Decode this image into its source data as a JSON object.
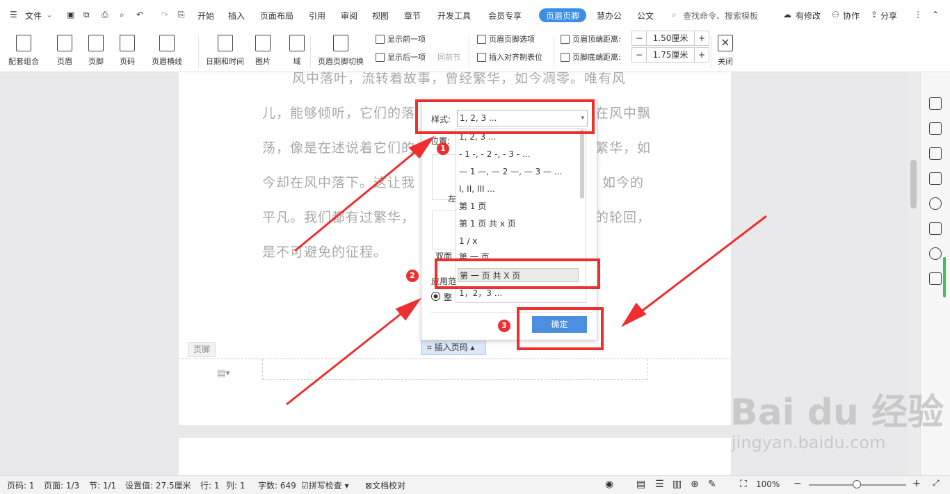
{
  "menubar": {
    "file": "文件",
    "tabs": [
      "开始",
      "插入",
      "页面布局",
      "引用",
      "审阅",
      "视图",
      "章节",
      "开发工具",
      "会员专享"
    ],
    "active_tab": "页眉页脚",
    "tabs_after": [
      "慧办公",
      "公文"
    ],
    "search": "查找命令、搜索模板",
    "has_changes": "有修改",
    "collab": "协作",
    "share": "分享"
  },
  "ribbon": {
    "combo": "配套组合",
    "header": "页眉",
    "footer": "页脚",
    "page_number": "页码",
    "header_line": "页眉横线",
    "datetime": "日期和时间",
    "picture": "图片",
    "field": "域",
    "switch": "页眉页脚切换",
    "show_prev": "显示前一项",
    "show_next": "显示后一项",
    "same_prev": "同前节",
    "hf_options": "页眉页脚选项",
    "insert_align_tab": "插入对齐制表位",
    "header_top_label": "页眉顶端距离:",
    "header_top_value": "1.50厘米",
    "footer_bottom_label": "页脚底端距离:",
    "footer_bottom_value": "1.75厘米",
    "close": "关闭"
  },
  "document": {
    "lines": [
      "风中落叶，流转着故事，曾经繁华，如今凋零。唯有风",
      "儿，能够倾听，它们的落",
      "在风中飘",
      "荡，像是在述说着它们的",
      "繁华，如",
      "今却在风中落下。这让我",
      "如今的",
      "平凡。我们都有过繁华，",
      "的轮回，",
      "是不可避免的征程。"
    ],
    "footer_tag": "页脚",
    "insert_page_number": "插入页码"
  },
  "dialog": {
    "style_label": "样式:",
    "style_value": "1, 2, 3 ...",
    "position_label": "位置:",
    "left_label": "左",
    "double_label": "双面",
    "apply_label": "应用范",
    "whole_label": "整",
    "options": [
      "1, 2, 3 ...",
      "- 1 -, - 2 -, - 3 - ...",
      "— 1 —, — 2 —, — 3 — ...",
      "I, II, III ...",
      "第 1 页",
      "第 1 页 共 x 页",
      "1 / x",
      "第 一 页",
      "第 一 页 共 X 页",
      "1，2，3 ..."
    ],
    "selected_option": "第 一 页 共 X 页",
    "ok": "确定"
  },
  "annotations": {
    "badge1": "1",
    "badge2": "2",
    "badge3": "3"
  },
  "statusbar": {
    "page": "页码: 1",
    "pages": "页面: 1/3",
    "section": "节: 1/1",
    "setting": "设置值: 27.5厘米",
    "row": "行: 1",
    "col": "列: 1",
    "words": "字数: 649",
    "spell": "拼写检查",
    "proof": "文档校对",
    "zoom": "100%"
  },
  "watermark": {
    "brand": "Bai du 经验",
    "url": "jingyan.baidu.com"
  }
}
